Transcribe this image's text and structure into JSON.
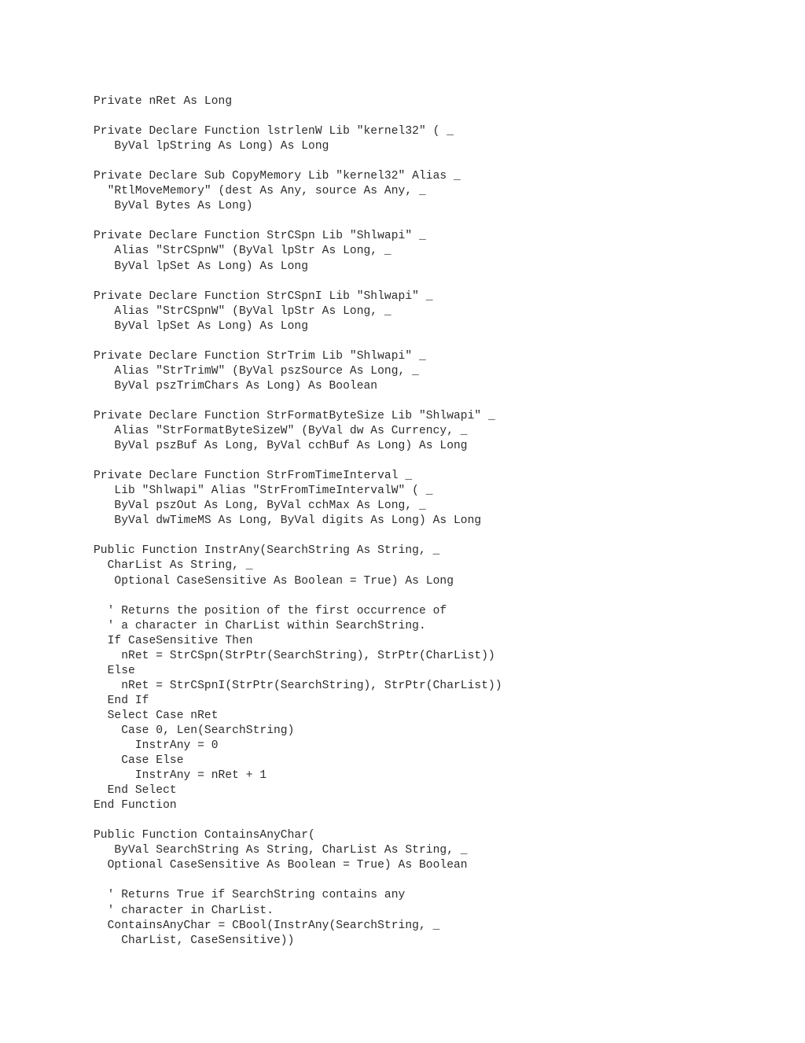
{
  "document": {
    "kind": "source-code-listing",
    "language": "Visual Basic",
    "background_color": "#ffffff",
    "text_color": "#2c2c2c"
  },
  "code": {
    "lines": [
      "Private nRet As Long",
      "",
      "Private Declare Function lstrlenW Lib \"kernel32\" ( _",
      "   ByVal lpString As Long) As Long",
      "",
      "Private Declare Sub CopyMemory Lib \"kernel32\" Alias _",
      "  \"RtlMoveMemory\" (dest As Any, source As Any, _",
      "   ByVal Bytes As Long)",
      "",
      "Private Declare Function StrCSpn Lib \"Shlwapi\" _",
      "   Alias \"StrCSpnW\" (ByVal lpStr As Long, _",
      "   ByVal lpSet As Long) As Long",
      "",
      "Private Declare Function StrCSpnI Lib \"Shlwapi\" _",
      "   Alias \"StrCSpnW\" (ByVal lpStr As Long, _",
      "   ByVal lpSet As Long) As Long",
      "",
      "Private Declare Function StrTrim Lib \"Shlwapi\" _",
      "   Alias \"StrTrimW\" (ByVal pszSource As Long, _",
      "   ByVal pszTrimChars As Long) As Boolean",
      "",
      "Private Declare Function StrFormatByteSize Lib \"Shlwapi\" _",
      "   Alias \"StrFormatByteSizeW\" (ByVal dw As Currency, _",
      "   ByVal pszBuf As Long, ByVal cchBuf As Long) As Long",
      "",
      "Private Declare Function StrFromTimeInterval _",
      "   Lib \"Shlwapi\" Alias \"StrFromTimeIntervalW\" ( _",
      "   ByVal pszOut As Long, ByVal cchMax As Long, _",
      "   ByVal dwTimeMS As Long, ByVal digits As Long) As Long",
      "",
      "Public Function InstrAny(SearchString As String, _",
      "  CharList As String, _",
      "   Optional CaseSensitive As Boolean = True) As Long",
      "",
      "  ' Returns the position of the first occurrence of",
      "  ' a character in CharList within SearchString.",
      "  If CaseSensitive Then",
      "    nRet = StrCSpn(StrPtr(SearchString), StrPtr(CharList))",
      "  Else",
      "    nRet = StrCSpnI(StrPtr(SearchString), StrPtr(CharList))",
      "  End If",
      "  Select Case nRet",
      "    Case 0, Len(SearchString)",
      "      InstrAny = 0",
      "    Case Else",
      "      InstrAny = nRet + 1",
      "  End Select",
      "End Function",
      "",
      "Public Function ContainsAnyChar(",
      "   ByVal SearchString As String, CharList As String, _",
      "  Optional CaseSensitive As Boolean = True) As Boolean",
      "",
      "  ' Returns True if SearchString contains any",
      "  ' character in CharList.",
      "  ContainsAnyChar = CBool(InstrAny(SearchString, _",
      "    CharList, CaseSensitive))"
    ]
  }
}
